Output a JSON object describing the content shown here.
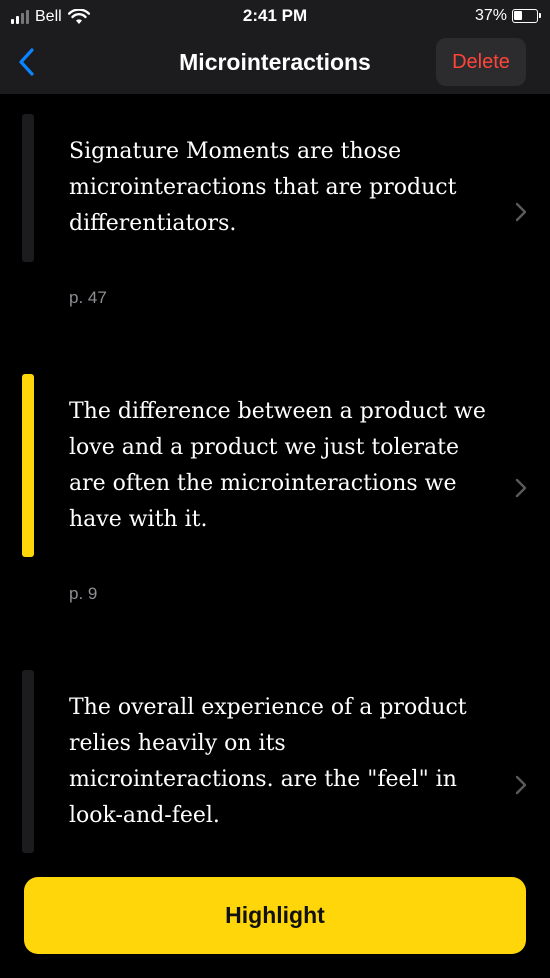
{
  "status_bar": {
    "carrier": "Bell",
    "time": "2:41 PM",
    "battery_percent": "37%",
    "battery_level": 0.37,
    "icons": [
      "signal-icon",
      "wifi-icon",
      "battery-icon"
    ]
  },
  "nav": {
    "back_icon": "chevron-left-icon",
    "title": "Microinteractions",
    "delete_label": "Delete"
  },
  "highlights": [
    {
      "text": "Signature Moments are those microinteractions that are product differentiators.",
      "page": "p. 47",
      "accent": "dark"
    },
    {
      "text": "The difference between a product we love and a product we just tolerate are often the microinteractions we have with it.",
      "page": "p. 9",
      "accent": "yellow"
    },
    {
      "text": "The overall experience of a product relies heavily on its microinteractions. are the \"feel\" in look-and-feel.",
      "page": "",
      "accent": "dark"
    }
  ],
  "bottom": {
    "highlight_label": "Highlight"
  },
  "colors": {
    "accent_yellow": "#ffd60a",
    "destructive": "#ff453a",
    "link_blue": "#0a84ff",
    "secondary_text": "#8e8e93"
  }
}
